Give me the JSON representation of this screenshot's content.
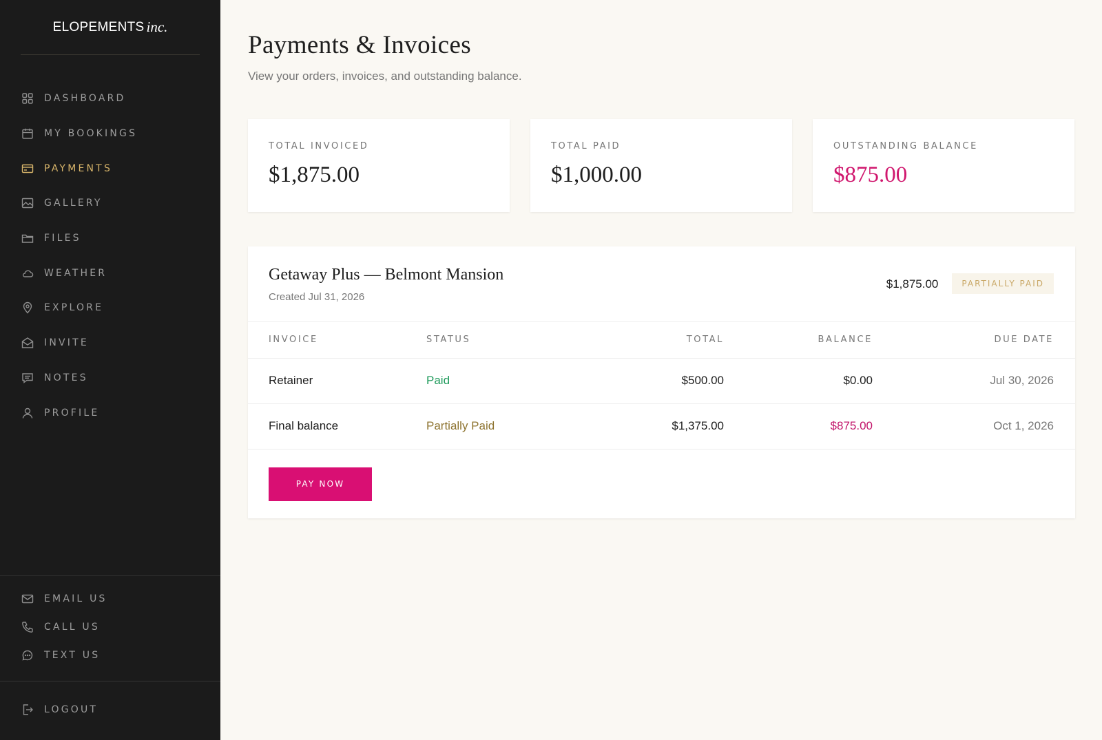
{
  "brand": {
    "name": "ELOPEMENTS",
    "script": "inc."
  },
  "nav": [
    {
      "label": "DASHBOARD",
      "icon": "grid-icon",
      "active": false
    },
    {
      "label": "MY BOOKINGS",
      "icon": "calendar-icon",
      "active": false
    },
    {
      "label": "PAYMENTS",
      "icon": "credit-card-icon",
      "active": true
    },
    {
      "label": "GALLERY",
      "icon": "image-icon",
      "active": false
    },
    {
      "label": "FILES",
      "icon": "folder-icon",
      "active": false
    },
    {
      "label": "WEATHER",
      "icon": "cloud-icon",
      "active": false
    },
    {
      "label": "EXPLORE",
      "icon": "map-pin-icon",
      "active": false
    },
    {
      "label": "INVITE",
      "icon": "envelope-open-icon",
      "active": false
    },
    {
      "label": "NOTES",
      "icon": "message-square-icon",
      "active": false
    },
    {
      "label": "PROFILE",
      "icon": "user-icon",
      "active": false
    }
  ],
  "contact": [
    {
      "label": "EMAIL US",
      "icon": "mail-icon"
    },
    {
      "label": "CALL US",
      "icon": "phone-icon"
    },
    {
      "label": "TEXT US",
      "icon": "chat-bubble-icon"
    }
  ],
  "logout": {
    "label": "LOGOUT",
    "icon": "logout-icon"
  },
  "page": {
    "title": "Payments & Invoices",
    "subtitle": "View your orders, invoices, and outstanding balance."
  },
  "stats": {
    "invoiced": {
      "label": "TOTAL INVOICED",
      "value": "$1,875.00"
    },
    "paid": {
      "label": "TOTAL PAID",
      "value": "$1,000.00"
    },
    "outstanding": {
      "label": "OUTSTANDING BALANCE",
      "value": "$875.00"
    }
  },
  "order": {
    "title": "Getaway Plus — Belmont Mansion",
    "created": "Created Jul 31, 2026",
    "total": "$1,875.00",
    "status_badge": "PARTIALLY PAID",
    "columns": {
      "invoice": "INVOICE",
      "status": "STATUS",
      "total": "TOTAL",
      "balance": "BALANCE",
      "due": "DUE DATE"
    },
    "rows": [
      {
        "invoice": "Retainer",
        "status": "Paid",
        "total": "$500.00",
        "balance": "$0.00",
        "due": "Jul 30, 2026"
      },
      {
        "invoice": "Final balance",
        "status": "Partially Paid",
        "total": "$1,375.00",
        "balance": "$875.00",
        "due": "Oct 1, 2026"
      }
    ],
    "pay_button": "PAY NOW"
  },
  "colors": {
    "sidebar_bg": "#1b1b1b",
    "accent_gold": "#d7b46a",
    "accent_pink": "#d90f73",
    "paid_green": "#1e9a5b",
    "partial_olive": "#8e7430",
    "page_bg": "#faf8f3"
  }
}
